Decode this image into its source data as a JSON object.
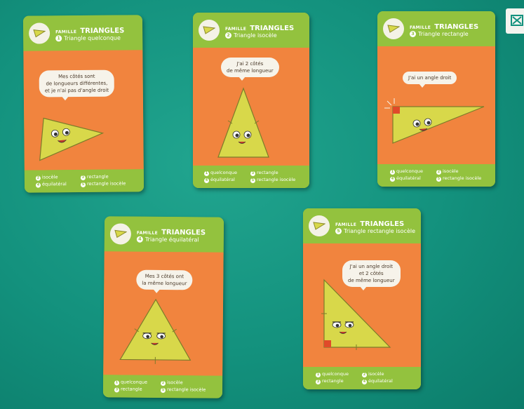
{
  "family": {
    "small": "FAMILLE",
    "big": "TRIANGLES"
  },
  "cards": [
    {
      "num": "1",
      "title": "Triangle quelconque",
      "bubble": [
        "Mes côtés sont",
        "de longueurs différentes,",
        "et je n'ai pas d'angle droit"
      ],
      "options": [
        {
          "num": "2",
          "label": "isocèle"
        },
        {
          "num": "3",
          "label": "rectangle"
        },
        {
          "num": "4",
          "label": "équilatéral"
        },
        {
          "num": "5",
          "label": "rectangle isocèle"
        }
      ]
    },
    {
      "num": "2",
      "title": "Triangle isocèle",
      "bubble": [
        "J'ai 2 côtés",
        "de même longueur"
      ],
      "options": [
        {
          "num": "1",
          "label": "quelconque"
        },
        {
          "num": "3",
          "label": "rectangle"
        },
        {
          "num": "4",
          "label": "équilatéral"
        },
        {
          "num": "5",
          "label": "rectangle isocèle"
        }
      ]
    },
    {
      "num": "3",
      "title": "Triangle rectangle",
      "bubble": [
        "J'ai un angle droit"
      ],
      "options": [
        {
          "num": "1",
          "label": "quelconque"
        },
        {
          "num": "2",
          "label": "isocèle"
        },
        {
          "num": "4",
          "label": "équilatéral"
        },
        {
          "num": "5",
          "label": "rectangle isocèle"
        }
      ]
    },
    {
      "num": "4",
      "title": "Triangle équilatéral",
      "bubble": [
        "Mes 3 côtés ont",
        "la même longueur"
      ],
      "options": [
        {
          "num": "1",
          "label": "quelconque"
        },
        {
          "num": "2",
          "label": "isocèle"
        },
        {
          "num": "3",
          "label": "rectangle"
        },
        {
          "num": "5",
          "label": "rectangle isocèle"
        }
      ]
    },
    {
      "num": "5",
      "title": "Triangle rectangle isocèle",
      "bubble": [
        "J'ai un angle droit",
        "et 2 côtés",
        "de même longueur"
      ],
      "options": [
        {
          "num": "1",
          "label": "quelconque"
        },
        {
          "num": "2",
          "label": "isocèle"
        },
        {
          "num": "3",
          "label": "rectangle"
        },
        {
          "num": "4",
          "label": "équilatéral"
        }
      ]
    }
  ],
  "colors": {
    "table": "#13917d",
    "card_green": "#93c23e",
    "card_orange": "#f1843e",
    "triangle": "#d8d84a"
  }
}
